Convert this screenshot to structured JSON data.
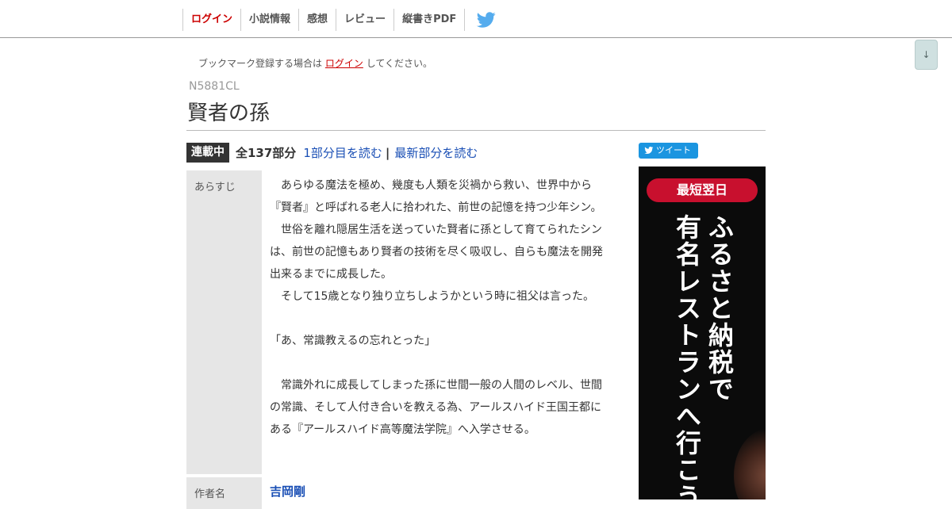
{
  "nav": {
    "items": [
      "ログイン",
      "小説情報",
      "感想",
      "レビュー",
      "縦書きPDF"
    ],
    "twitter_icon": "twitter-bird-icon"
  },
  "scroll_button": "↓",
  "bookmark": {
    "prefix": "ブックマーク登録する場合は",
    "login_link": "ログイン",
    "suffix": "してください。"
  },
  "novel": {
    "ncode": "N5881CL",
    "title": "賢者の孫",
    "status_badge": "連載中",
    "total_parts": "全137部分",
    "first_link": "1部分目を読む",
    "separator": "|",
    "latest_link": "最新部分を読む"
  },
  "tweet_button": "ツイート",
  "info": {
    "synopsis_label": "あらすじ",
    "synopsis_lines": [
      "　あらゆる魔法を極め、幾度も人類を災禍から救い、世界中から",
      "『賢者』と呼ばれる老人に拾われた、前世の記憶を持つ少年シン。",
      "　世俗を離れ隠居生活を送っていた賢者に孫として育てられたシン",
      "は、前世の記憶もあり賢者の技術を尽く吸収し、自らも魔法を開発",
      "出来るまでに成長した。",
      "　そして15歳となり独り立ちしようかという時に祖父は言った。",
      "",
      "「あ、常識教えるの忘れとった」",
      "",
      "　常識外れに成長してしまった孫に世間一般の人間のレベル、世間",
      "の常識、そして人付き合いを教える為、アールスハイド王国王都に",
      "ある『アールスハイド高等魔法学院』へ入学させる。"
    ],
    "author_label": "作者名",
    "author_name": "吉岡剛"
  },
  "ad": {
    "pill_text": "最短翌日",
    "column1": "ふるさと納税で",
    "column2": "有名レストランへ行こう",
    "colors": {
      "background": "#0b0b0b",
      "pill": "#c8102e"
    }
  },
  "colors": {
    "link": "#1a4fb5",
    "login": "#cc0000",
    "twitter": "#1b95e0"
  }
}
